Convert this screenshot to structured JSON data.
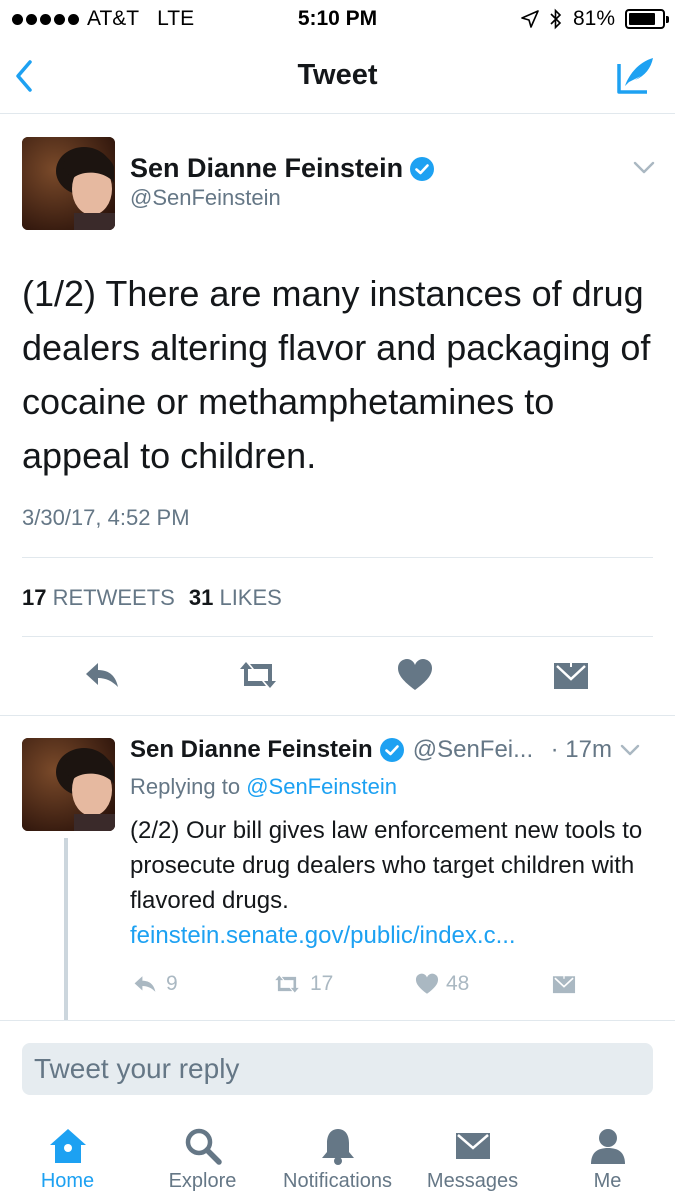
{
  "status_bar": {
    "carrier": "AT&T",
    "network": "LTE",
    "time": "5:10 PM",
    "battery_percent": "81%",
    "battery_level": 0.81,
    "icons": [
      "signal-dots",
      "location-arrow-icon",
      "bluetooth-icon",
      "battery-icon"
    ]
  },
  "nav": {
    "title": "Tweet",
    "back_icon": "chevron-left-icon",
    "compose_icon": "compose-quill-icon"
  },
  "main_tweet": {
    "author_name": "Sen Dianne Feinstein",
    "author_handle": "@SenFeinstein",
    "verified": true,
    "text": "(1/2) There are many instances of drug dealers altering flavor and packaging of cocaine or methamphetamines to appeal to children.",
    "timestamp": "3/30/17, 4:52 PM",
    "retweets_count": "17",
    "retweets_label": "RETWEETS",
    "likes_count": "31",
    "likes_label": "LIKES",
    "actions": [
      "reply-icon",
      "retweet-icon",
      "heart-icon",
      "dm-envelope-icon"
    ]
  },
  "reply_tweet": {
    "author_name": "Sen Dianne Feinstein",
    "author_handle": "@SenFei...",
    "time": "· 17m",
    "replying_prefix": "Replying to",
    "replying_to": "@SenFeinstein",
    "text": "(2/2) Our bill gives law enforcement new tools to prosecute drug dealers who target children with flavored drugs.",
    "link": "feinstein.senate.gov/public/index.c...",
    "reply_count": "9",
    "retweet_count": "17",
    "like_count": "48"
  },
  "reply_bar": {
    "placeholder": "Tweet your reply"
  },
  "tabs": [
    {
      "label": "Home",
      "icon": "home-icon",
      "active": true
    },
    {
      "label": "Explore",
      "icon": "search-icon",
      "active": false
    },
    {
      "label": "Notifications",
      "icon": "bell-icon",
      "active": false
    },
    {
      "label": "Messages",
      "icon": "envelope-icon",
      "active": false
    },
    {
      "label": "Me",
      "icon": "person-icon",
      "active": false
    }
  ],
  "colors": {
    "accent": "#1da1f2",
    "text": "#14171a",
    "muted": "#657786",
    "light_icon": "#aab8c2",
    "divider": "#e1e8ed"
  }
}
